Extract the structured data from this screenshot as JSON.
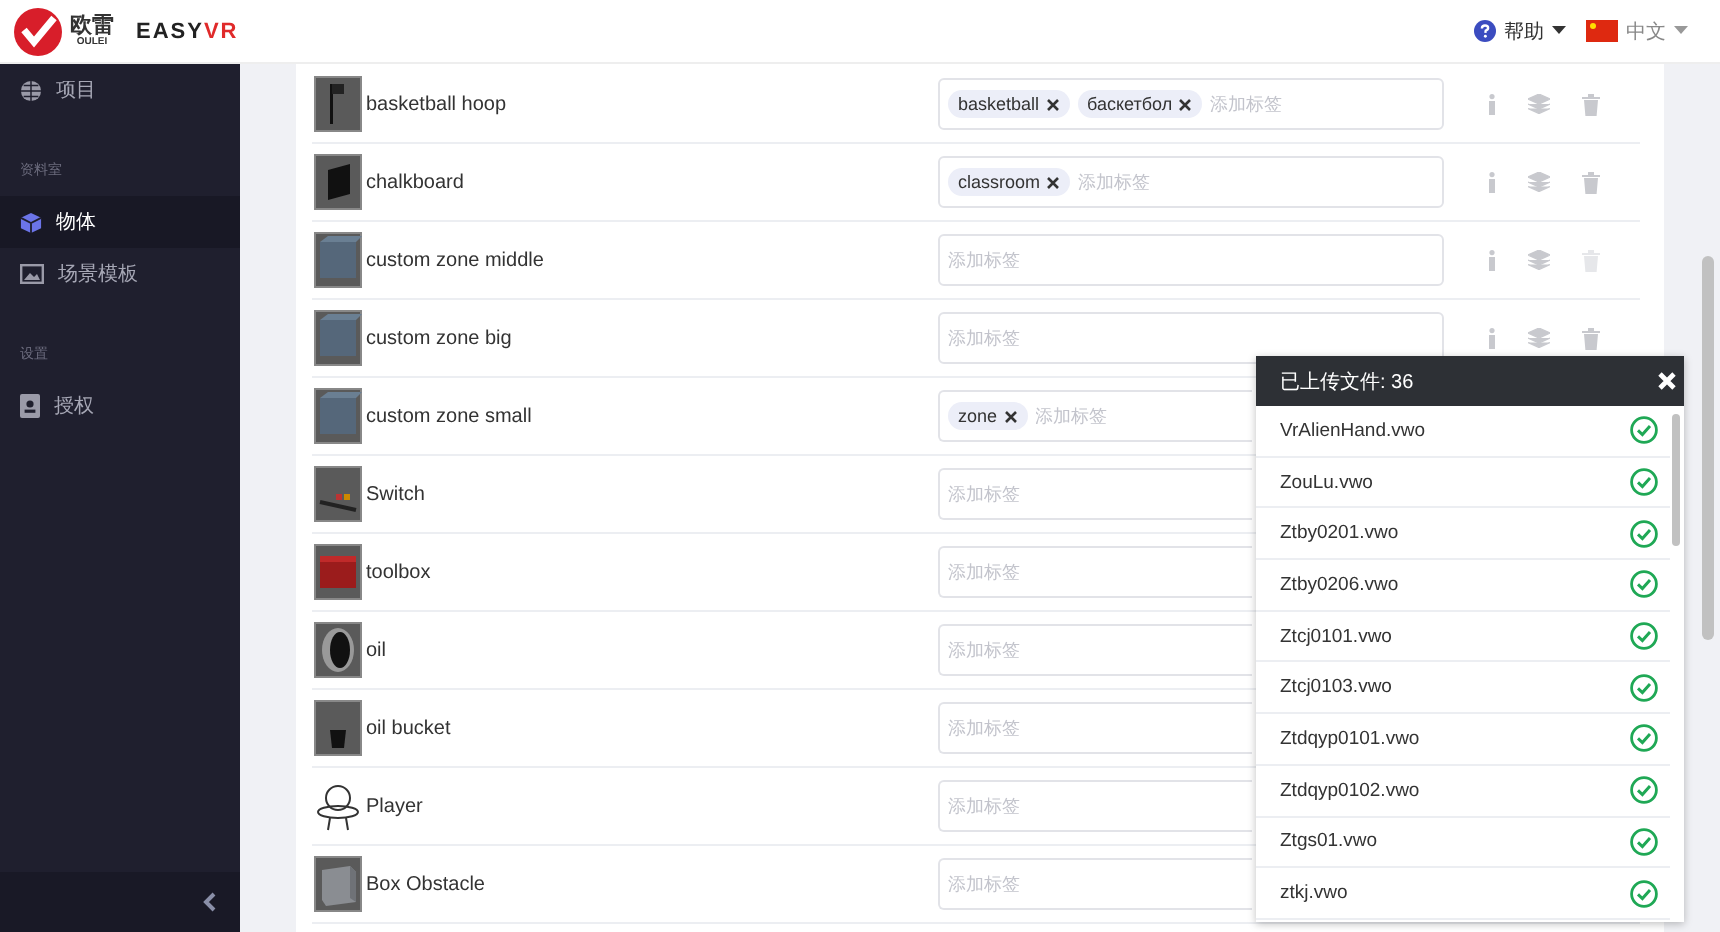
{
  "header": {
    "logo_cn": "欧雷",
    "logo_en": "OULEI",
    "brand_main": "EASY",
    "brand_accent": "VR",
    "help": "帮助",
    "language": "中文"
  },
  "sidebar": {
    "groups": [
      {
        "items": [
          {
            "label": "项目",
            "selected": false
          }
        ]
      },
      {
        "title": "资料室",
        "items": [
          {
            "label": "物体",
            "selected": true
          },
          {
            "label": "场景模板",
            "selected": false
          }
        ]
      },
      {
        "title": "设置",
        "items": [
          {
            "label": "授权",
            "selected": false
          }
        ]
      }
    ]
  },
  "objects": [
    {
      "name": "basketball hoop",
      "tags": [
        "basketball",
        "баскетбол"
      ],
      "placeholder": "添加标签",
      "delete_disabled": false
    },
    {
      "name": "chalkboard",
      "tags": [
        "classroom"
      ],
      "placeholder": "添加标签",
      "delete_disabled": false
    },
    {
      "name": "custom zone middle",
      "placeholder": "添加标签",
      "delete_disabled": true
    },
    {
      "name": "custom zone big",
      "placeholder": "添加标签",
      "delete_disabled": false
    },
    {
      "name": "custom zone small",
      "tags": [
        "zone"
      ],
      "placeholder": "添加标签"
    },
    {
      "name": "Switch",
      "placeholder": "添加标签"
    },
    {
      "name": "toolbox",
      "placeholder": "添加标签"
    },
    {
      "name": "oil",
      "placeholder": "添加标签"
    },
    {
      "name": "oil bucket",
      "placeholder": "添加标签"
    },
    {
      "name": "Player",
      "placeholder": "添加标签"
    },
    {
      "name": "Box Obstacle",
      "placeholder": "添加标签"
    }
  ],
  "upload_panel": {
    "title": "已上传文件: 36",
    "files": [
      {
        "name": "VrAlienHand.vwo",
        "uploaded": true
      },
      {
        "name": "ZouLu.vwo",
        "uploaded": true
      },
      {
        "name": "Ztby0201.vwo",
        "uploaded": true
      },
      {
        "name": "Ztby0206.vwo",
        "uploaded": true
      },
      {
        "name": "Ztcj0101.vwo",
        "uploaded": true
      },
      {
        "name": "Ztcj0103.vwo",
        "uploaded": true
      },
      {
        "name": "Ztdqyp0101.vwo",
        "uploaded": true
      },
      {
        "name": "Ztdqyp0102.vwo",
        "uploaded": true
      },
      {
        "name": "Ztgs01.vwo",
        "uploaded": true
      },
      {
        "name": "ztkj.vwo",
        "uploaded": true
      }
    ]
  }
}
